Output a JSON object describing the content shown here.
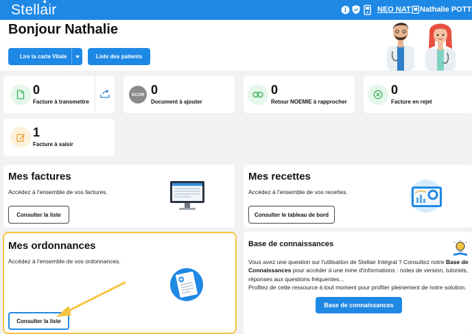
{
  "header": {
    "brand": "Stellair",
    "account": "NEO NAT",
    "user": "Nathalie POTTIEZ",
    "icons": [
      "info-icon",
      "shield-icon",
      "card-reader-icon",
      "building-icon"
    ]
  },
  "greeting": {
    "title": "Bonjour Nathalie",
    "read_card_label": "Lire la carte Vitale",
    "patients_label": "Liste des patients"
  },
  "stats": [
    {
      "value": "0",
      "label": "Facture à transmettre",
      "icon": "document-icon"
    },
    {
      "value": "0",
      "label": "Document à ajouter",
      "icon": "scor-badge-icon",
      "badge": "SCOR"
    },
    {
      "value": "0",
      "label": "Retour NOEMIE à rapprocher",
      "icon": "link-icon"
    },
    {
      "value": "0",
      "label": "Facture en rejet",
      "icon": "reject-icon"
    },
    {
      "value": "1",
      "label": "Facture à saisir",
      "icon": "edit-icon"
    }
  ],
  "factures": {
    "title": "Mes factures",
    "desc": "Accédez à l'ensemble de vos factures.",
    "button": "Consulter la liste"
  },
  "recettes": {
    "title": "Mes recettes",
    "desc": "Accédez à l'ensemble de vos recettes.",
    "button": "Consulter le tableau de bord"
  },
  "ordonnances": {
    "title": "Mes ordonnances",
    "desc": "Accédez à l'ensemble de vos ordonnances.",
    "button": "Consulter la liste"
  },
  "knowledge": {
    "title": "Base de connaissances",
    "text_1": "Vous avez une question sur l'utilisation de Stellair Intégral ? Consultez notre ",
    "bold_1": "Base de",
    "bold_2": "Connaissances",
    "text_2": " pour accéder à une mine d'informations : notes de version, tutoriels,",
    "text_3": "réponses aux questions fréquentes...",
    "text_4": "Profitez de cette ressource à tout moment pour profiter pleinement de notre solution.",
    "button": "Base de connaissances"
  },
  "colors": {
    "brand_blue": "#1e88e5",
    "highlight": "#f5c342",
    "page_bg": "#f1f2f4"
  }
}
